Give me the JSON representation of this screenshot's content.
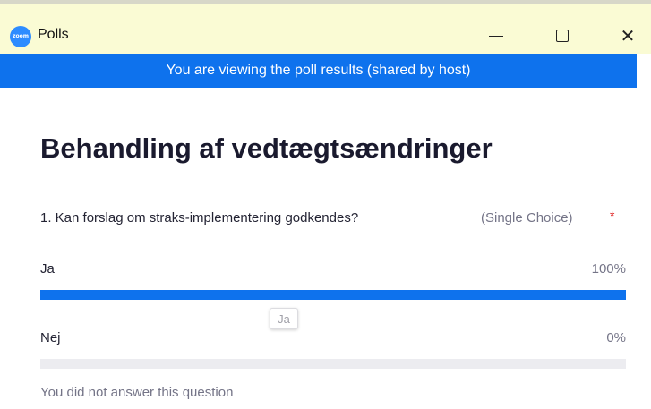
{
  "window": {
    "title": "Polls",
    "app_logo_text": "zoom",
    "controls": {
      "minimize": "minimize-icon",
      "maximize": "maximize-icon",
      "close": "close-icon"
    }
  },
  "banner": {
    "text": "You are viewing the poll results (shared by host)",
    "color": "#0e72ed"
  },
  "poll": {
    "title": "Behandling af vedtægtsændringer",
    "questions": [
      {
        "text": "1. Kan forslag om straks-implementering godkendes?",
        "type": "(Single Choice)",
        "required_marker": "*",
        "options": [
          {
            "label": "Ja",
            "percent_text": "100%",
            "fraction": 1.0
          },
          {
            "label": "Nej",
            "percent_text": "0%",
            "fraction": 0.0
          }
        ],
        "note": "You did not answer this question"
      }
    ]
  },
  "tooltip": {
    "text": "Ja"
  },
  "colors": {
    "accent": "#0e72ed",
    "titlebar": "#fafbd4",
    "required": "#e02828"
  }
}
